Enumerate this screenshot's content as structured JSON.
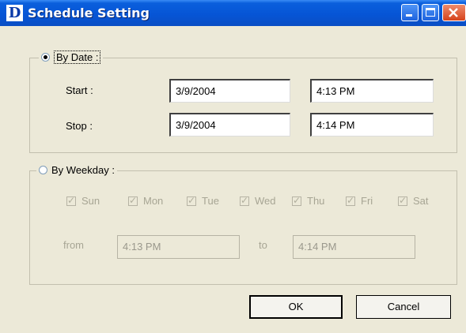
{
  "window": {
    "title": "Schedule Setting",
    "app_icon_letter": "D"
  },
  "by_date": {
    "label": "By Date :",
    "selected": true,
    "start_label": "Start :",
    "start_date": "3/9/2004",
    "start_time": "4:13 PM",
    "stop_label": "Stop :",
    "stop_date": "3/9/2004",
    "stop_time": "4:14 PM"
  },
  "by_weekday": {
    "label": "By Weekday :",
    "selected": false,
    "days": [
      {
        "label": "Sun",
        "checked": true
      },
      {
        "label": "Mon",
        "checked": true
      },
      {
        "label": "Tue",
        "checked": true
      },
      {
        "label": "Wed",
        "checked": true
      },
      {
        "label": "Thu",
        "checked": true
      },
      {
        "label": "Fri",
        "checked": true
      },
      {
        "label": "Sat",
        "checked": true
      }
    ],
    "from_label": "from",
    "from_time": "4:13 PM",
    "to_label": "to",
    "to_time": "4:14 PM"
  },
  "buttons": {
    "ok": "OK",
    "cancel": "Cancel"
  },
  "icons": {
    "minimize": "minimize-icon",
    "maximize": "maximize-icon",
    "close": "close-icon"
  },
  "colors": {
    "titlebar": "#0655d6",
    "dialog_bg": "#ECE9D8",
    "close_button": "#d6431c"
  }
}
